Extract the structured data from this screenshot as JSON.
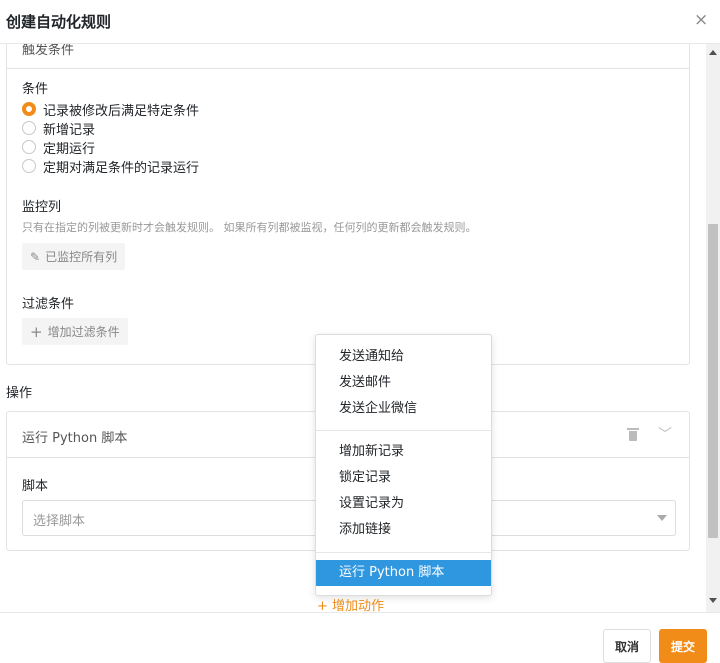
{
  "dialog": {
    "title": "创建自动化规则",
    "close_icon": "×"
  },
  "trigger": {
    "header_label": "触发条件",
    "header_chevron": "⌃",
    "condition_label": "条件",
    "options": [
      {
        "label": "记录被修改后满足特定条件",
        "checked": true
      },
      {
        "label": "新增记录",
        "checked": false
      },
      {
        "label": "定期运行",
        "checked": false
      },
      {
        "label": "定期对满足条件的记录运行",
        "checked": false
      }
    ],
    "watch_label": "监控列",
    "watch_hint": "只有在指定的列被更新时才会触发规则。 如果所有列都被监视，任何列的更新都会触发规则。",
    "watch_button": "已监控所有列",
    "watch_button_icon": "✎",
    "filter_label": "过滤条件",
    "filter_button": "增加过滤条件",
    "filter_button_icon": "+"
  },
  "operations": {
    "label": "操作",
    "action_title": "运行 Python 脚本",
    "script_label": "脚本",
    "script_placeholder": "选择脚本",
    "action_chevron": "﹀"
  },
  "menu": {
    "group1": [
      "发送通知给",
      "发送邮件",
      "发送企业微信"
    ],
    "group2": [
      "增加新记录",
      "锁定记录",
      "设置记录为",
      "添加链接"
    ],
    "group3": [
      "运行 Python 脚本"
    ],
    "active_item": "运行 Python 脚本"
  },
  "add_action": "+ 增加动作",
  "footer": {
    "cancel": "取消",
    "submit": "提交"
  },
  "colors": {
    "accent": "#f08c17",
    "menu_active": "#2f97e0"
  }
}
